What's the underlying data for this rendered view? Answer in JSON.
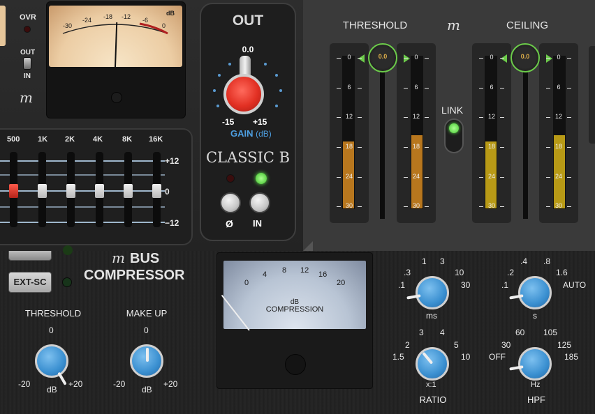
{
  "input_meter": {
    "ovr_label": "OVR",
    "out_label": "OUT",
    "in_label": "IN",
    "vu_unit": "dB",
    "vu_ticks": [
      "-30",
      "-24",
      "-18",
      "-12",
      "-6",
      "0"
    ]
  },
  "eq": {
    "bands": [
      "500",
      "1K",
      "2K",
      "4K",
      "8K",
      "16K"
    ],
    "scale": [
      "+12",
      "0",
      "−12"
    ]
  },
  "out_section": {
    "title": "OUT",
    "gain_value": "0.0",
    "min_label": "-15",
    "max_label": "+15",
    "gain_label": "GAIN",
    "gain_unit": "(dB)",
    "mode_label": "CLASSIC B",
    "phase_label": "Ø",
    "in_label": "IN"
  },
  "limiter": {
    "threshold_label": "THRESHOLD",
    "ceiling_label": "CEILING",
    "link_label": "LINK",
    "threshold_value": "0.0",
    "ceiling_value": "0.0",
    "scale": [
      "0",
      "6",
      "12",
      "18",
      "24",
      "30"
    ],
    "colors": {
      "threshold_fill": "#b8771e",
      "ceiling_fill": "#b89a16",
      "link_led": "#5ee04a"
    }
  },
  "bus": {
    "brand_line1": "BUS",
    "brand_line2": "COMPRESSOR",
    "extsc_label": "EXT-SC",
    "threshold": {
      "label": "THRESHOLD",
      "top": "0",
      "min": "-20",
      "unit": "dB",
      "max": "+20"
    },
    "makeup": {
      "label": "MAKE UP",
      "top": "0",
      "min": "-20",
      "unit": "dB",
      "max": "+20"
    },
    "meter": {
      "unit": "dB",
      "label": "COMPRESSION",
      "ticks": [
        "0",
        "4",
        "8",
        "12",
        "16",
        "20"
      ]
    },
    "attack": {
      "unit": "ms",
      "values": [
        ".3",
        "1",
        "3",
        ".1",
        "10",
        "30"
      ]
    },
    "release": {
      "unit": "s",
      "values": [
        ".4",
        ".8",
        ".2",
        "1.6",
        ".1",
        "AUTO"
      ]
    },
    "ratio": {
      "label": "RATIO",
      "unit": "x:1",
      "values": [
        "3",
        "4",
        "2",
        "5",
        "1.5",
        "10"
      ]
    },
    "hpf": {
      "label": "HPF",
      "unit": "Hz",
      "values": [
        "60",
        "105",
        "30",
        "125",
        "OFF",
        "185"
      ]
    }
  }
}
